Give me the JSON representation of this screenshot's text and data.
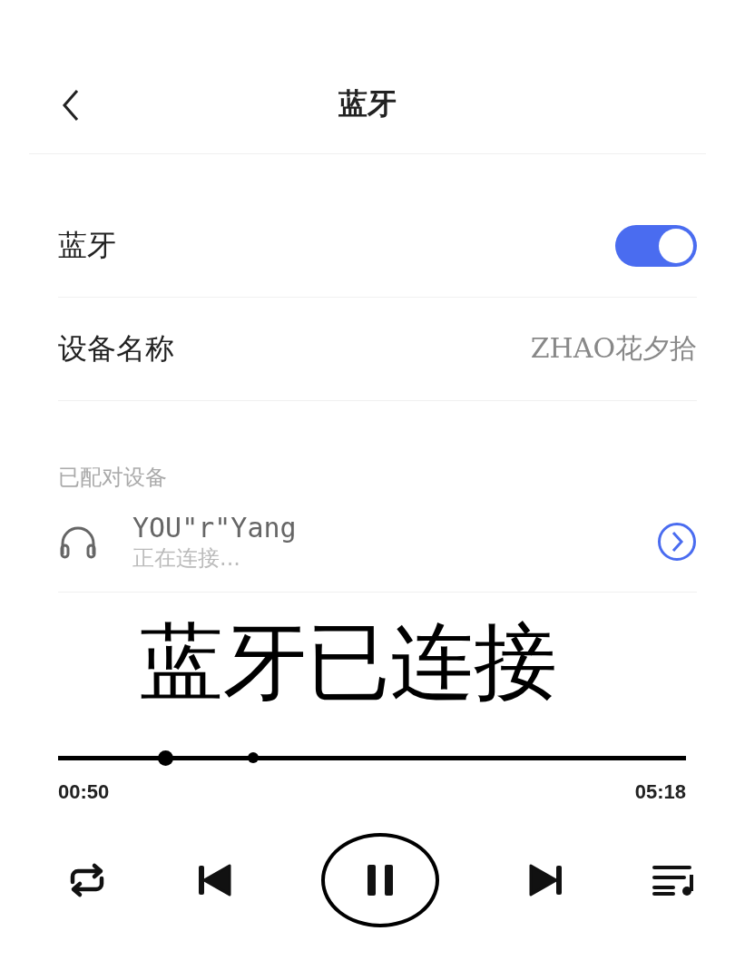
{
  "header": {
    "title": "蓝牙"
  },
  "settings": [
    {
      "kind": "toggle",
      "label": "蓝牙",
      "on": true
    },
    {
      "kind": "value",
      "label": "设备名称",
      "value": "ZHAO花夕拾"
    }
  ],
  "paired_section": {
    "label": "已配对设备",
    "devices": [
      {
        "name": "YOU\"r\"Yang",
        "status": "正在连接..."
      }
    ]
  },
  "overlay_caption": "蓝牙已连接",
  "player": {
    "progress": {
      "level": 0.17,
      "marker": {
        "level": 0.31
      }
    },
    "elapsed": "00:50",
    "duration": "05:18",
    "playing": true
  }
}
